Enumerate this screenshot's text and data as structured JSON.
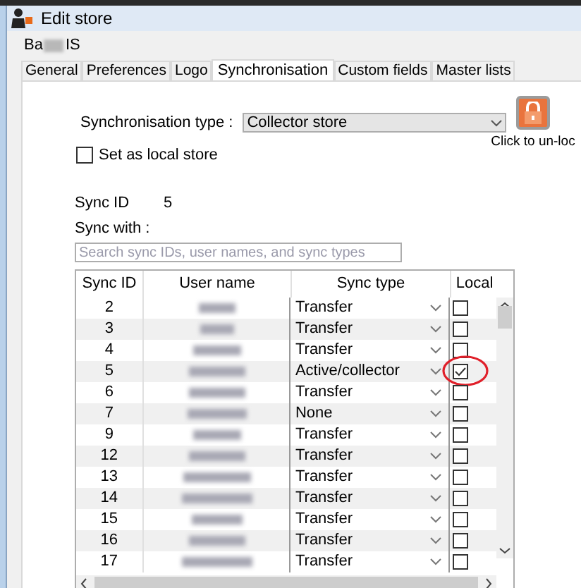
{
  "window": {
    "title": "Edit store"
  },
  "store_name": {
    "start": "Ba",
    "end": "IS"
  },
  "tabs": [
    {
      "label": "General",
      "selected": false
    },
    {
      "label": "Preferences",
      "selected": false
    },
    {
      "label": "Logo",
      "selected": false
    },
    {
      "label": "Synchronisation",
      "selected": true
    },
    {
      "label": "Custom fields",
      "selected": false
    },
    {
      "label": "Master lists",
      "selected": false
    }
  ],
  "sync_type": {
    "label": "Synchronisation type :",
    "value": "Collector store"
  },
  "local_store": {
    "label": "Set as local store",
    "checked": false
  },
  "lock": {
    "label": "Click to un-loc"
  },
  "sync_id": {
    "label": "Sync ID",
    "value": "5"
  },
  "sync_with": {
    "label": "Sync with :"
  },
  "search": {
    "placeholder": "Search sync IDs, user names, and sync types"
  },
  "table": {
    "columns": [
      "Sync ID",
      "User name",
      "Sync type",
      "Local"
    ],
    "rows": [
      {
        "sync_id": "2",
        "sync_type": "Transfer",
        "local": false
      },
      {
        "sync_id": "3",
        "sync_type": "Transfer",
        "local": false
      },
      {
        "sync_id": "4",
        "sync_type": "Transfer",
        "local": false
      },
      {
        "sync_id": "5",
        "sync_type": "Active/collector",
        "local": true,
        "highlighted": true
      },
      {
        "sync_id": "6",
        "sync_type": "Transfer",
        "local": false
      },
      {
        "sync_id": "7",
        "sync_type": "None",
        "local": false
      },
      {
        "sync_id": "9",
        "sync_type": "Transfer",
        "local": false
      },
      {
        "sync_id": "12",
        "sync_type": "Transfer",
        "local": false
      },
      {
        "sync_id": "13",
        "sync_type": "Transfer",
        "local": false
      },
      {
        "sync_id": "14",
        "sync_type": "Transfer",
        "local": false
      },
      {
        "sync_id": "15",
        "sync_type": "Transfer",
        "local": false
      },
      {
        "sync_id": "16",
        "sync_type": "Transfer",
        "local": false
      },
      {
        "sync_id": "17",
        "sync_type": "Transfer",
        "local": false
      }
    ]
  }
}
